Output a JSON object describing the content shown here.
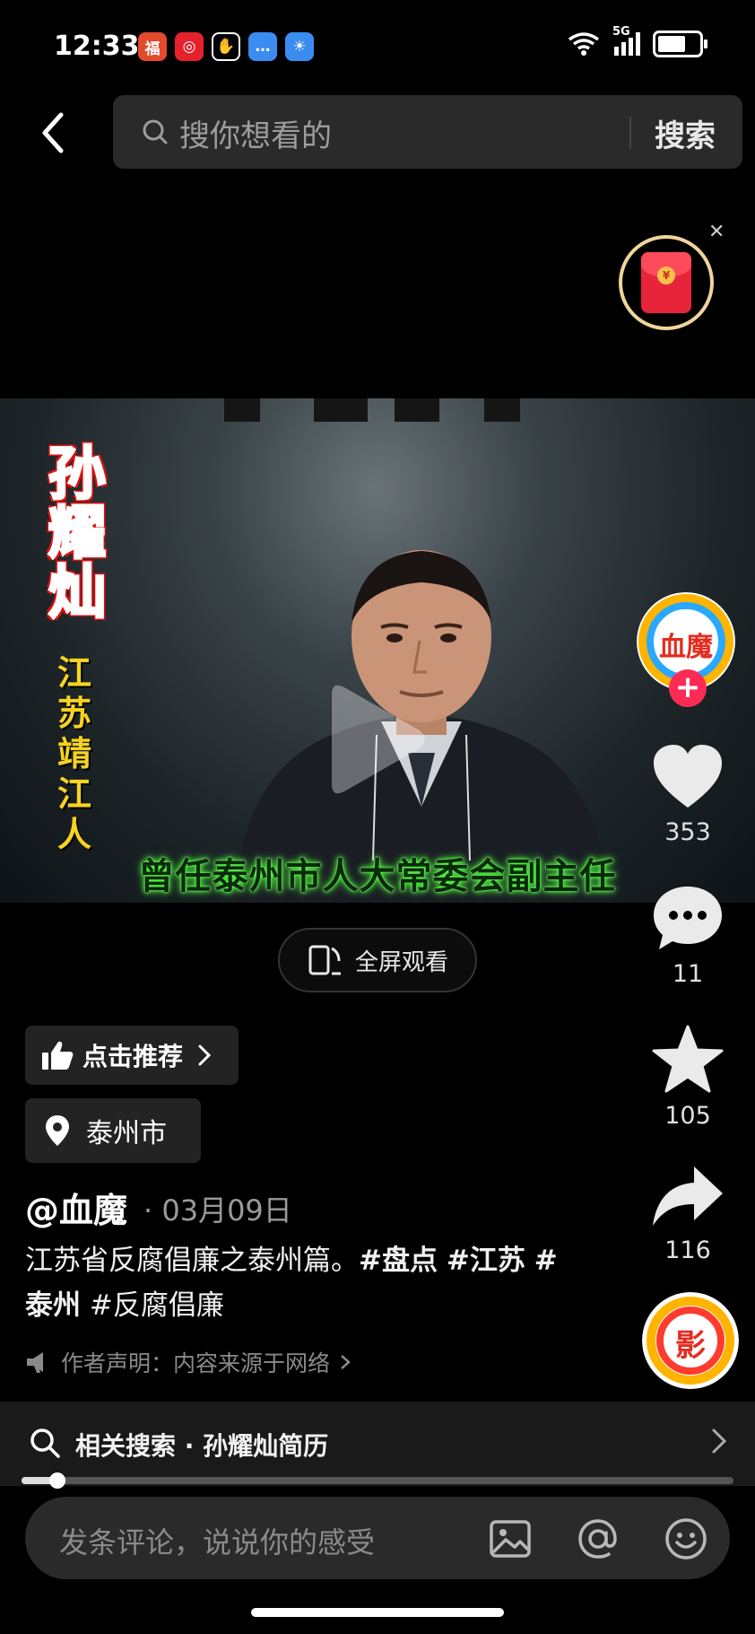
{
  "status_bar": {
    "time": "12:33",
    "apps": [
      {
        "icon": "red-app-icon",
        "color": "#e24a2b",
        "glyph": "福"
      },
      {
        "icon": "target-app-icon",
        "color": "#e5222b",
        "glyph": "◎"
      },
      {
        "icon": "hand-app-icon",
        "color": "#000000",
        "glyph": "✋"
      },
      {
        "icon": "message-app-icon",
        "color": "#3b8cf0",
        "glyph": "…"
      },
      {
        "icon": "weather-app-icon",
        "color": "#3b8cf0",
        "glyph": "☀"
      }
    ],
    "network": "5G",
    "wifi_label": "6"
  },
  "search": {
    "placeholder": "搜你想看的",
    "button": "搜索"
  },
  "video": {
    "name_vertical": "孙耀灿",
    "place_vertical": "江苏靖江人",
    "caption": "曾任泰州市人大常委会副主任"
  },
  "fullscreen": {
    "label": "全屏观看"
  },
  "rail": {
    "avatar_text": "血魔",
    "likes": "353",
    "comments": "11",
    "favorites": "105",
    "shares": "116",
    "disc_text": "影"
  },
  "recommend": {
    "label": "点击推荐"
  },
  "location": {
    "label": "泰州市"
  },
  "post": {
    "author": "@血魔",
    "date": "· 03月09日",
    "desc_plain": "江苏省反腐倡廉之泰州篇。",
    "tag1": "#盘点",
    "tag2": "#江苏",
    "tag3": "#泰州",
    "tag4": "#反腐倡廉",
    "disclaimer": "作者声明：内容来源于网络"
  },
  "related": {
    "text": "相关搜索 · 孙耀灿简历"
  },
  "progress": {
    "fraction": 0.05
  },
  "comment": {
    "placeholder": "发条评论，说说你的感受"
  },
  "colors": {
    "accent": "#fe2c55",
    "background": "#000000",
    "caption_glow": "#4cff3a",
    "name_blue": "#1f4fb0",
    "place_yellow": "#f7d321"
  }
}
